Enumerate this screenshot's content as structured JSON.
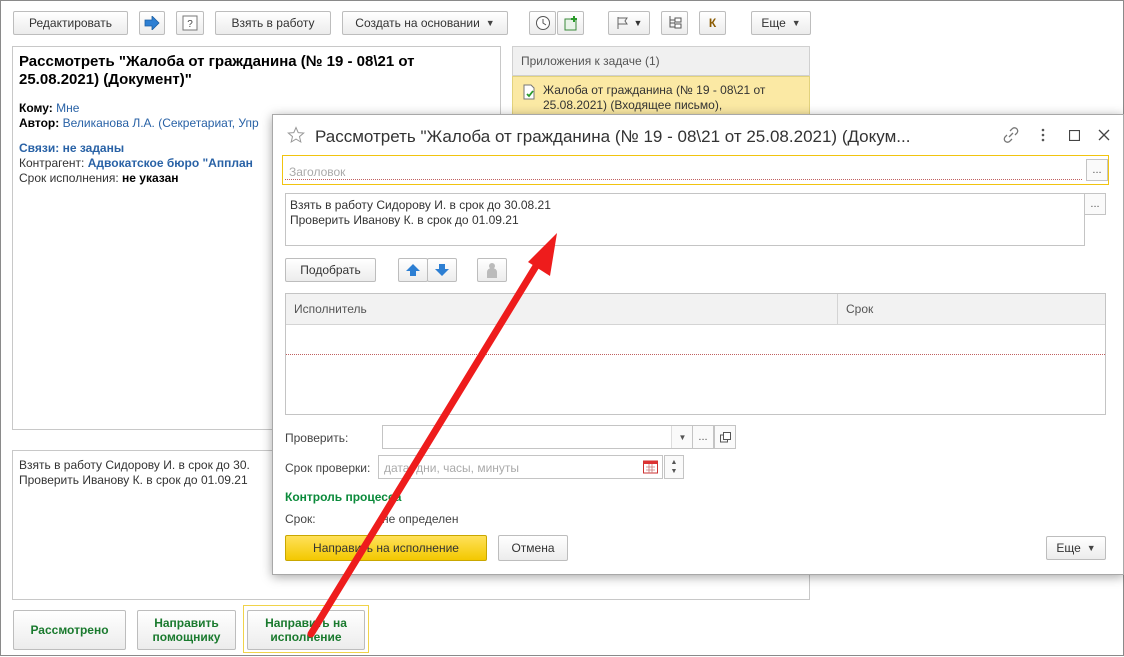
{
  "toolbar": {
    "edit": "Редактировать",
    "take": "Взять в работу",
    "create_based": "Создать на основании",
    "k_label": "К",
    "more": "Еще"
  },
  "task": {
    "title": "Рассмотреть \"Жалоба от гражданина (№ 19 - 08\\21 от 25.08.2021) (Документ)\"",
    "to_label": "Кому:",
    "to_value": "Мне",
    "author_label": "Автор:",
    "author_value": "Великанова Л.А. (Секретариат, Упр",
    "links_label": "Связи:",
    "links_value": "не заданы",
    "contractor_label": "Контрагент:",
    "contractor_value": "Адвокатское бюро \"Апплан",
    "deadline_label": "Срок исполнения:",
    "deadline_value": "не указан"
  },
  "attachments": {
    "header": "Приложения к задаче (1)",
    "item": "Жалоба от гражданина (№ 19 - 08\\21 от 25.08.2021) (Входящее письмо),"
  },
  "comment": {
    "line1": "Взять в работу Сидорову И. в срок до 30.",
    "line2": "Проверить Иванову К. в срок до 01.09.21"
  },
  "bottom_buttons": {
    "reviewed": "Рассмотрено",
    "send_assistant": "Направить помощнику",
    "send_execution": "Направить на исполнение"
  },
  "dialog": {
    "title": "Рассмотреть \"Жалоба от гражданина (№ 19 - 08\\21 от 25.08.2021) (Докум...",
    "subject_placeholder": "Заголовок",
    "text_line1": "Взять в работу Сидорову И. в срок до 30.08.21",
    "text_line2": "Проверить Иванову К. в срок до 01.09.21",
    "pick": "Подобрать",
    "col_executor": "Исполнитель",
    "col_deadline": "Срок",
    "check_label": "Проверить:",
    "check_deadline_label": "Срок проверки:",
    "check_deadline_placeholder": "дата, дни, часы, минуты",
    "control_header": "Контроль процесса",
    "term_label": "Срок:",
    "term_value": "не определен",
    "send": "Направить на исполнение",
    "cancel": "Отмена",
    "more": "Еще"
  },
  "colors": {
    "accent_yellow": "#f3c800",
    "link_blue": "#2962a6",
    "green": "#0a8a3a",
    "arrow_red": "#ee1c1c"
  }
}
